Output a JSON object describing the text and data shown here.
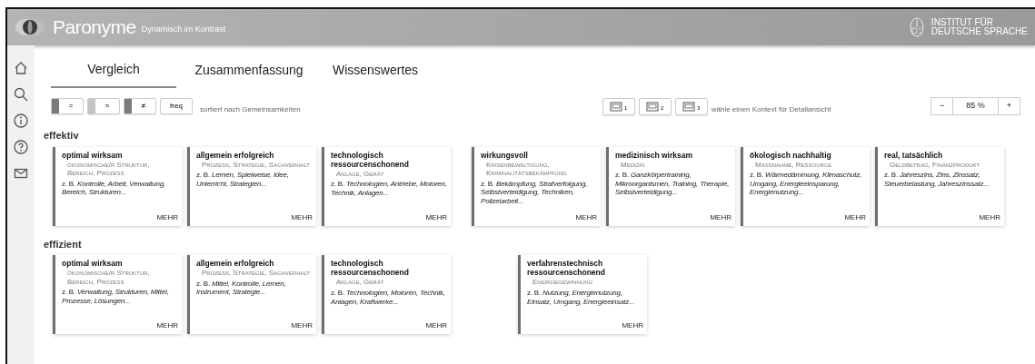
{
  "header": {
    "title": "Paronyme",
    "subtitle": "Dynamisch im Kontrast",
    "institute": [
      "INSTITUT FÜR",
      "DEUTSCHE SPRACHE"
    ]
  },
  "sidebar": {
    "items": [
      {
        "kind": "home"
      },
      {
        "kind": "search"
      },
      {
        "kind": "info"
      },
      {
        "kind": "help"
      },
      {
        "kind": "mail"
      }
    ]
  },
  "tabs": [
    {
      "label": "Vergleich",
      "selected": true
    },
    {
      "label": "Zusammenfassung",
      "selected": false
    },
    {
      "label": "Wissenswertes",
      "selected": false
    }
  ],
  "filters": [
    {
      "label": "=",
      "color": "#7a7a7a"
    },
    {
      "label": "≈",
      "color": "#c4c4c4"
    },
    {
      "label": "≠",
      "color": "#7a7a7a"
    },
    {
      "label": "freq"
    }
  ],
  "sort_note": "sortiert nach Gemeinsamkeiten",
  "contexts": [
    "1",
    "2",
    "3"
  ],
  "context_note": "wähle einen Kontext für Detailansicht",
  "zoom": {
    "minus": "−",
    "value": "85 %",
    "plus": "+"
  },
  "groups": [
    {
      "word": "effektiv",
      "cards": [
        {
          "title": "optimal wirksam",
          "category": "ökonomische/r Struktur, Bereich, Prozess",
          "examples": "z. B. *Kontrolle, Arbeit, Verwaltung, Bereich, Strukturen...*",
          "more": "MEHR"
        },
        {
          "title": "allgemein erfolgreich",
          "category": "Prozess, Strategie, Sachverhalt",
          "examples": "z. B. *Lernen, Spielweise, Idee, Unterricht, Strategien...*",
          "more": "MEHR"
        },
        {
          "title": "technologisch ressourcenschonend",
          "category": "Anlage, Gerät",
          "examples": "z. B. *Technologien, Antriebe, Motoren, Technik, Anlagen...*",
          "more": "MEHR"
        },
        {
          "title": "wirkungsvoll",
          "category": "Krisenbewältigung, Kriminalitätsbekämpfung",
          "examples": "z. B. *Bekämpfung, Strafverfolgung, Selbstverteidigung, Techniken, Polizeiarbeit...*",
          "more": "MEHR"
        },
        {
          "title": "medizinisch wirksam",
          "category": "Medizin",
          "examples": "z. B. *Ganzkörpertraining, Mikroorganismen, Training, Therapie, Selbstverteidigung...*",
          "more": "MEHR"
        },
        {
          "title": "ökologisch nachhaltig",
          "category": "Maßnahme, Ressource",
          "examples": "z. B. *Wärmedämmung, Klimaschutz, Umgang, Energieeinsparung, Energienutzung...*",
          "more": "MEHR"
        },
        {
          "title": "real, tatsächlich",
          "category": "Geldbetrag, Finanzprodukt",
          "examples": "z. B. *Jahreszins, Zins, Zinssatz, Steuerbelastung, Jahreszinssatz...*",
          "more": "MEHR"
        }
      ]
    },
    {
      "word": "effizient",
      "cards": [
        {
          "title": "optimal wirksam",
          "category": "ökonomische/r Struktur, Bereich, Prozess",
          "examples": "z. B. *Verwaltung, Strukturen, Mittel, Prozesse, Lösungen...*",
          "more": "MEHR"
        },
        {
          "title": "allgemein erfolgreich",
          "category": "Prozess, Strategie, Sachverhalt",
          "examples": "z. B. *Mittel, Kontrolle, Lernen, Instrument, Strategie...*",
          "more": "MEHR"
        },
        {
          "title": "technologisch ressourcenschonend",
          "category": "Anlage, Gerät",
          "examples": "z. B. *Technologien, Motoren, Technik, Anlagen, Kraftwerke...*",
          "more": "MEHR"
        },
        {
          "title": "verfahrenstechnisch ressourcenschonend",
          "category": "Energiegewinnung",
          "examples": "z. B. *Nutzung, Energienutzung, Einsatz, Umgang, Energieeinsatz...*",
          "more": "MEHR"
        }
      ]
    }
  ]
}
